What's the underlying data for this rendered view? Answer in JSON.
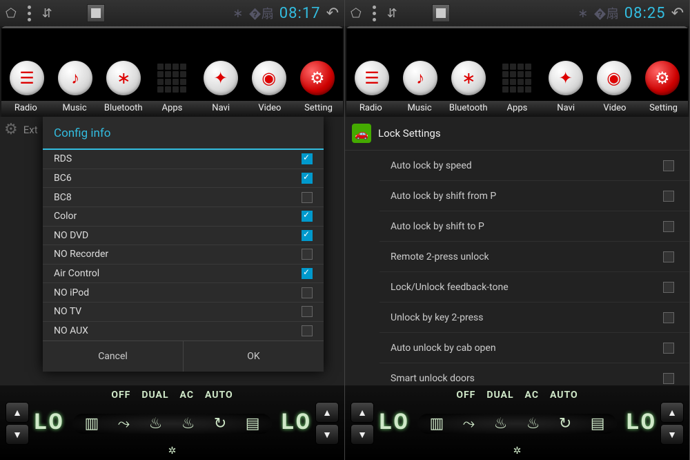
{
  "left": {
    "status": {
      "time": "08:17"
    },
    "apps": [
      "Radio",
      "Music",
      "Bluetooth",
      "Apps",
      "Navi",
      "Video",
      "Setting"
    ],
    "behind_label": "Ext",
    "dialog": {
      "title": "Config info",
      "items": [
        {
          "label": "RDS",
          "checked": true
        },
        {
          "label": "BC6",
          "checked": true
        },
        {
          "label": "BC8",
          "checked": false
        },
        {
          "label": "Color",
          "checked": true
        },
        {
          "label": "NO DVD",
          "checked": true
        },
        {
          "label": "NO Recorder",
          "checked": false
        },
        {
          "label": "Air Control",
          "checked": true
        },
        {
          "label": "NO iPod",
          "checked": false
        },
        {
          "label": "NO TV",
          "checked": false
        },
        {
          "label": "NO AUX",
          "checked": false
        }
      ],
      "cancel": "Cancel",
      "ok": "OK"
    },
    "climate": {
      "temp_left": "LO",
      "temp_right": "LO",
      "modes": [
        "OFF",
        "DUAL",
        "AC",
        "AUTO"
      ]
    }
  },
  "right": {
    "status": {
      "time": "08:25"
    },
    "apps": [
      "Radio",
      "Music",
      "Bluetooth",
      "Apps",
      "Navi",
      "Video",
      "Setting"
    ],
    "header": "Lock Settings",
    "items": [
      {
        "label": "Auto lock by speed",
        "checked": false
      },
      {
        "label": "Auto lock by shift from P",
        "checked": false
      },
      {
        "label": "Auto lock by shift to P",
        "checked": false
      },
      {
        "label": "Remote 2-press unlock",
        "checked": false
      },
      {
        "label": "Lock/Unlock feedback-tone",
        "checked": false
      },
      {
        "label": "Unlock by key 2-press",
        "checked": false
      },
      {
        "label": "Auto unlock by cab open",
        "checked": false
      },
      {
        "label": "Smart unlock doors",
        "checked": false
      }
    ],
    "climate": {
      "temp_left": "LO",
      "temp_right": "LO",
      "modes": [
        "OFF",
        "DUAL",
        "AC",
        "AUTO"
      ]
    }
  }
}
